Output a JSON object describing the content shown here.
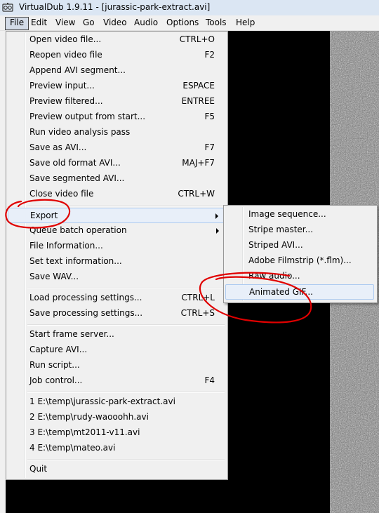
{
  "window": {
    "title": "VirtualDub 1.9.11 - [jurassic-park-extract.avi]"
  },
  "menubar": {
    "items": [
      "File",
      "Edit",
      "View",
      "Go",
      "Video",
      "Audio",
      "Options",
      "Tools",
      "Help"
    ]
  },
  "file_menu": {
    "items": [
      {
        "label": "Open video file...",
        "shortcut": "CTRL+O"
      },
      {
        "label": "Reopen video file",
        "shortcut": "F2"
      },
      {
        "label": "Append AVI segment...",
        "shortcut": ""
      },
      {
        "label": "Preview input...",
        "shortcut": "ESPACE"
      },
      {
        "label": "Preview filtered...",
        "shortcut": "ENTREE"
      },
      {
        "label": "Preview output from start...",
        "shortcut": "F5"
      },
      {
        "label": "Run video analysis pass",
        "shortcut": ""
      },
      {
        "label": "Save as AVI...",
        "shortcut": "F7"
      },
      {
        "label": "Save old format AVI...",
        "shortcut": "MAJ+F7"
      },
      {
        "label": "Save segmented AVI...",
        "shortcut": ""
      },
      {
        "label": "Close video file",
        "shortcut": "CTRL+W"
      },
      {
        "label": "Export",
        "shortcut": ""
      },
      {
        "label": "Queue batch operation",
        "shortcut": ""
      },
      {
        "label": "File Information...",
        "shortcut": ""
      },
      {
        "label": "Set text information...",
        "shortcut": ""
      },
      {
        "label": "Save WAV...",
        "shortcut": ""
      },
      {
        "label": "Load processing settings...",
        "shortcut": "CTRL+L"
      },
      {
        "label": "Save processing settings...",
        "shortcut": "CTRL+S"
      },
      {
        "label": "Start frame server...",
        "shortcut": ""
      },
      {
        "label": "Capture AVI...",
        "shortcut": ""
      },
      {
        "label": "Run script...",
        "shortcut": ""
      },
      {
        "label": "Job control...",
        "shortcut": "F4"
      },
      {
        "label": "1 E:\\temp\\jurassic-park-extract.avi",
        "shortcut": ""
      },
      {
        "label": "2 E:\\temp\\rudy-waooohh.avi",
        "shortcut": ""
      },
      {
        "label": "3 E:\\temp\\mt2011-v11.avi",
        "shortcut": ""
      },
      {
        "label": "4 E:\\temp\\mateo.avi",
        "shortcut": ""
      },
      {
        "label": "Quit",
        "shortcut": ""
      }
    ]
  },
  "export_menu": {
    "items": [
      {
        "label": "Image sequence..."
      },
      {
        "label": "Stripe master..."
      },
      {
        "label": "Striped AVI..."
      },
      {
        "label": "Adobe Filmstrip (*.flm)..."
      },
      {
        "label": "Raw audio..."
      },
      {
        "label": "Animated GIF..."
      }
    ]
  },
  "colors": {
    "annotation": "#e00000",
    "highlight_bg": "#e8eff9",
    "highlight_border": "#aecbf0"
  }
}
